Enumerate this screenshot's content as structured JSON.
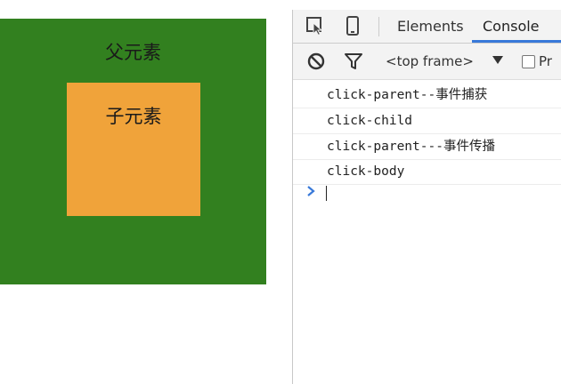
{
  "demo": {
    "parent_label": "父元素",
    "child_label": "子元素",
    "colors": {
      "parent_bg": "#32801f",
      "child_bg": "#f0a33a"
    }
  },
  "devtools": {
    "toolbar": {
      "inspect_icon": "inspect-element-icon",
      "device_icon": "device-toolbar-icon",
      "tabs": [
        {
          "label": "Elements",
          "active": false
        },
        {
          "label": "Console",
          "active": true
        }
      ],
      "accent": "#3879d9"
    },
    "filter_bar": {
      "clear_icon": "clear-console-icon",
      "filter_icon": "filter-icon",
      "frame_select": "<top frame>",
      "preserve_log_label": "Pr"
    },
    "console": {
      "logs": [
        {
          "code": "click-parent--",
          "zh": "事件捕获"
        },
        {
          "code": "click-child",
          "zh": ""
        },
        {
          "code": "click-parent---",
          "zh": "事件传播"
        },
        {
          "code": "click-body",
          "zh": ""
        }
      ],
      "prompt_icon": "prompt-chevron-icon"
    }
  }
}
